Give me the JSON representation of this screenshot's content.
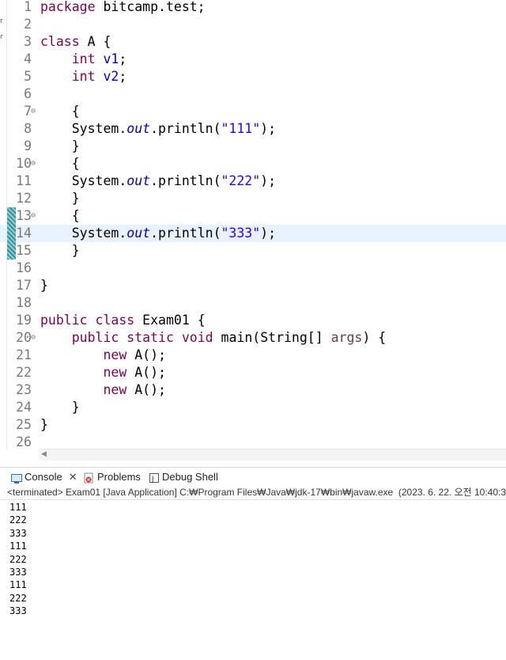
{
  "editor": {
    "lines": [
      {
        "n": "1",
        "segs": [
          [
            "kw",
            "package"
          ],
          [
            "plain",
            " bitcamp.test;"
          ]
        ]
      },
      {
        "n": "2",
        "segs": []
      },
      {
        "n": "3",
        "segs": [
          [
            "kw",
            "class"
          ],
          [
            "plain",
            " A {"
          ]
        ]
      },
      {
        "n": "4",
        "segs": [
          [
            "plain",
            "    "
          ],
          [
            "kw",
            "int"
          ],
          [
            "plain",
            " "
          ],
          [
            "field",
            "v1"
          ],
          [
            "plain",
            ";"
          ]
        ]
      },
      {
        "n": "5",
        "segs": [
          [
            "plain",
            "    "
          ],
          [
            "kw",
            "int"
          ],
          [
            "plain",
            " "
          ],
          [
            "field",
            "v2"
          ],
          [
            "plain",
            ";"
          ]
        ]
      },
      {
        "n": "6",
        "segs": []
      },
      {
        "n": "7",
        "fold": true,
        "segs": [
          [
            "plain",
            "    {"
          ]
        ]
      },
      {
        "n": "8",
        "segs": [
          [
            "plain",
            "    System."
          ],
          [
            "italic-field",
            "out"
          ],
          [
            "plain",
            ".println("
          ],
          [
            "str",
            "\"111\""
          ],
          [
            "plain",
            ");"
          ]
        ]
      },
      {
        "n": "9",
        "segs": [
          [
            "plain",
            "    }"
          ]
        ]
      },
      {
        "n": "10",
        "fold": true,
        "segs": [
          [
            "plain",
            "    {"
          ]
        ]
      },
      {
        "n": "11",
        "segs": [
          [
            "plain",
            "    System."
          ],
          [
            "italic-field",
            "out"
          ],
          [
            "plain",
            ".println("
          ],
          [
            "str",
            "\"222\""
          ],
          [
            "plain",
            ");"
          ]
        ]
      },
      {
        "n": "12",
        "segs": [
          [
            "plain",
            "    }"
          ]
        ]
      },
      {
        "n": "13",
        "fold": true,
        "segs": [
          [
            "plain",
            "    {"
          ]
        ]
      },
      {
        "n": "14",
        "current": true,
        "segs": [
          [
            "plain",
            "    System."
          ],
          [
            "italic-field",
            "out"
          ],
          [
            "plain",
            ".println("
          ],
          [
            "str",
            "\"333\""
          ],
          [
            "plain",
            ");"
          ]
        ]
      },
      {
        "n": "15",
        "segs": [
          [
            "plain",
            "    }"
          ]
        ]
      },
      {
        "n": "16",
        "segs": []
      },
      {
        "n": "17",
        "segs": [
          [
            "plain",
            "}"
          ]
        ]
      },
      {
        "n": "18",
        "segs": []
      },
      {
        "n": "19",
        "segs": [
          [
            "kw",
            "public"
          ],
          [
            "plain",
            " "
          ],
          [
            "kw",
            "class"
          ],
          [
            "plain",
            " Exam01 {"
          ]
        ]
      },
      {
        "n": "20",
        "fold": true,
        "segs": [
          [
            "plain",
            "    "
          ],
          [
            "kw",
            "public"
          ],
          [
            "plain",
            " "
          ],
          [
            "kw",
            "static"
          ],
          [
            "plain",
            " "
          ],
          [
            "kw",
            "void"
          ],
          [
            "plain",
            " main(String[] "
          ],
          [
            "var",
            "args"
          ],
          [
            "plain",
            ") {"
          ]
        ]
      },
      {
        "n": "21",
        "segs": [
          [
            "plain",
            "        "
          ],
          [
            "kw",
            "new"
          ],
          [
            "plain",
            " A();"
          ]
        ]
      },
      {
        "n": "22",
        "segs": [
          [
            "plain",
            "        "
          ],
          [
            "kw",
            "new"
          ],
          [
            "plain",
            " A();"
          ]
        ]
      },
      {
        "n": "23",
        "segs": [
          [
            "plain",
            "        "
          ],
          [
            "kw",
            "new"
          ],
          [
            "plain",
            " A();"
          ]
        ]
      },
      {
        "n": "24",
        "segs": [
          [
            "plain",
            "    }"
          ]
        ]
      },
      {
        "n": "25",
        "segs": [
          [
            "plain",
            "}"
          ]
        ]
      },
      {
        "n": "26",
        "segs": []
      }
    ],
    "fold_glyph": "⊖",
    "left_strip_chars": [
      "r",
      "r"
    ]
  },
  "scrollbar": {
    "left_arrow": "◀"
  },
  "console": {
    "tabs": [
      {
        "label": "Console",
        "icon": "console-icon",
        "close": "✕",
        "active": true
      },
      {
        "label": "Problems",
        "icon": "problems-icon"
      },
      {
        "label": "Debug Shell",
        "icon": "debug-shell-icon"
      }
    ],
    "status": "<terminated> Exam01 [Java Application] C:₩Program Files₩Java₩jdk-17₩bin₩javaw.exe  (2023. 6. 22. 오전 10:40:3",
    "output": [
      "111",
      "222",
      "333",
      "111",
      "222",
      "333",
      "111",
      "222",
      "333"
    ]
  },
  "colors": {
    "keyword": "#7f0055",
    "field": "#0000c0",
    "string": "#2a00ff",
    "local_var": "#6a3e3e",
    "current_line": "#e8f2fe"
  }
}
